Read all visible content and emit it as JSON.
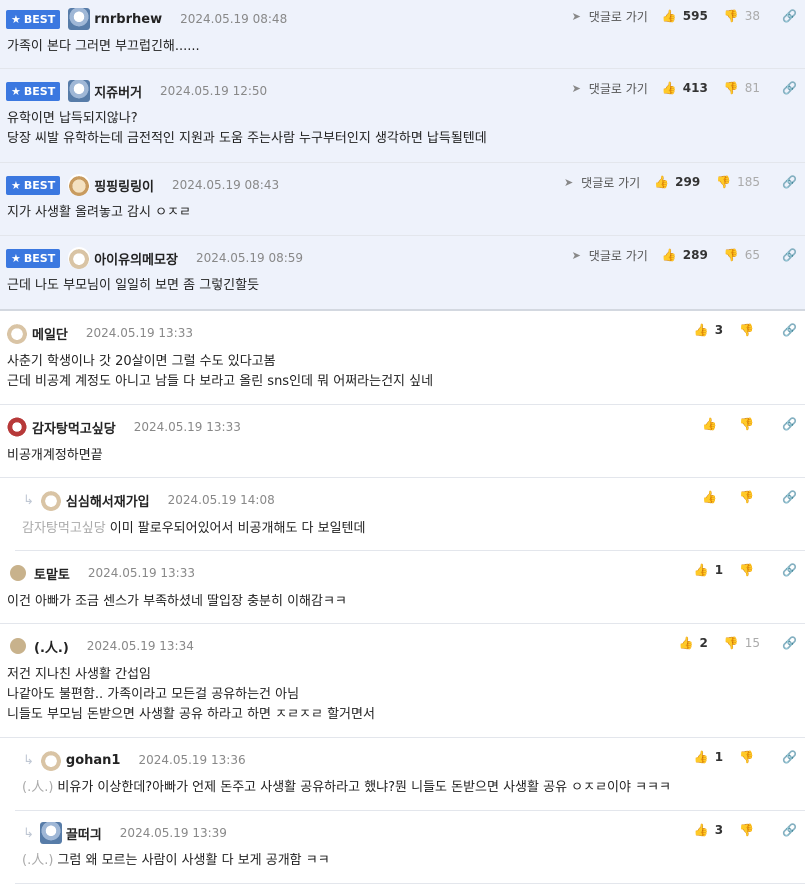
{
  "labels": {
    "best": "BEST",
    "goto": "댓글로 가기"
  },
  "comments": [
    {
      "nick": "rnrbrhew",
      "date": "2024.05.19 08:48",
      "up": "595",
      "down": "38",
      "lines": [
        "가족이 본다 그러면 부끄럽긴해......"
      ]
    },
    {
      "nick": "지쥬버거",
      "date": "2024.05.19 12:50",
      "up": "413",
      "down": "81",
      "lines": [
        "유학이면 납득되지않나?",
        "당장 씨발 유학하는데 금전적인 지원과 도움 주는사람 누구부터인지 생각하면 납득될텐데"
      ]
    },
    {
      "nick": "핑핑링링이",
      "date": "2024.05.19 08:43",
      "up": "299",
      "down": "185",
      "lines": [
        "지가 사생활 올려놓고 감시 ㅇㅈㄹ"
      ]
    },
    {
      "nick": "아이유의메모장",
      "date": "2024.05.19 08:59",
      "up": "289",
      "down": "65",
      "lines": [
        "근데 나도 부모님이 일일히 보면 좀 그렇긴할듯"
      ]
    },
    {
      "nick": "메일단",
      "date": "2024.05.19 13:33",
      "up": "3",
      "down": "",
      "lines": [
        "사춘기 학생이나 갓 20살이면 그럴 수도 있다고봄",
        "근데 비공계 계정도 아니고 남들 다 보라고 올린 sns인데 뭐 어쩌라는건지 싶네"
      ]
    },
    {
      "nick": "감자탕먹고싶당",
      "date": "2024.05.19 13:33",
      "up": "",
      "down": "",
      "lines": [
        "비공개계정하면끝"
      ]
    },
    {
      "nick": "심심해서재가입",
      "date": "2024.05.19 14:08",
      "up": "",
      "down": "",
      "target": "감자탕먹고싶당",
      "lines": [
        "이미 팔로우되어있어서 비공개해도 다 보일텐데"
      ]
    },
    {
      "nick": "토맡토",
      "date": "2024.05.19 13:33",
      "up": "1",
      "down": "",
      "lines": [
        "이건 아빠가 조금 센스가 부족하셨네 딸입장 충분히 이해감ㅋㅋ"
      ]
    },
    {
      "nick": "(.人.)",
      "date": "2024.05.19 13:34",
      "up": "2",
      "down": "15",
      "lines": [
        "저건 지나친 사생활 간섭임",
        "나같아도 불편함.. 가족이라고 모든걸 공유하는건 아님",
        "니들도 부모님 돈받으면 사생활 공유 하라고 하면 ㅈㄹㅈㄹ 할거면서"
      ]
    },
    {
      "nick": "gohan1",
      "date": "2024.05.19 13:36",
      "up": "1",
      "down": "",
      "target": "(.人.)",
      "lines": [
        "비유가 이상한데?아빠가 언제 돈주고 사생활 공유하라고 했냐?뭔 니들도 돈받으면 사생활 공유 ㅇㅈㄹ이야 ㅋㅋㅋ"
      ]
    },
    {
      "nick": "끌떠긔",
      "date": "2024.05.19 13:39",
      "up": "3",
      "down": "",
      "target": "(.人.)",
      "lines": [
        "그럼 왜 모르는 사람이 사생활 다 보게 공개함 ㅋㅋ"
      ]
    }
  ]
}
